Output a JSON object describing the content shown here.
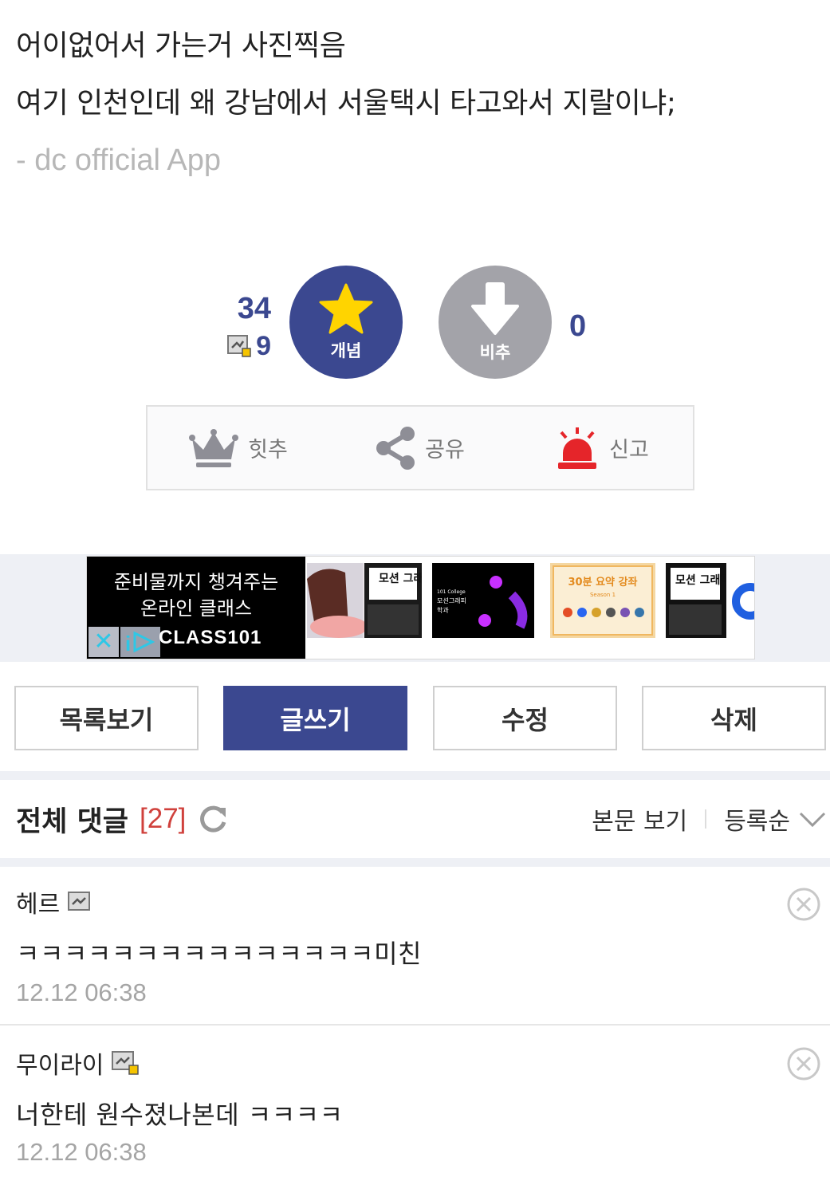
{
  "post": {
    "lines": [
      "어이없어서 가는거 사진찍음",
      "여기 인천인데 왜 강남에서 서울택시 타고와서 지랄이냐;"
    ],
    "app_sign": "- dc official App"
  },
  "recommend": {
    "up_count": "34",
    "fix_count": "9",
    "up_label": "개념",
    "down_label": "비추",
    "down_count": "0"
  },
  "actions": {
    "hit_label": "힛추",
    "share_label": "공유",
    "report_label": "신고"
  },
  "ad": {
    "line1": "준비물까지 챙겨주는",
    "line2": "온라인 클래스",
    "brand": "CLASS101",
    "thumb1_text": "모션 그래픽",
    "thumb2_lines": [
      "101 College",
      "모션그래피",
      "학과"
    ],
    "thumb3_title": "30분 요약 강좌",
    "thumb3_sub": "Season 1",
    "thumb4_text": "모션 그래픽"
  },
  "buttons": {
    "list": "목록보기",
    "write": "글쓰기",
    "edit": "수정",
    "delete": "삭제"
  },
  "comments_header": {
    "title": "전체 댓글",
    "count": "[27]",
    "view_body": "본문 보기",
    "sort": "등록순"
  },
  "comments": [
    {
      "author": "헤르",
      "text": "ㅋㅋㅋㅋㅋㅋㅋㅋㅋㅋㅋㅋㅋㅋㅋ미친",
      "date": "12.12 06:38"
    },
    {
      "author": "무이라이",
      "text": "너한테 원수졌나본데 ㅋㅋㅋㅋ",
      "date": "12.12 06:38"
    }
  ],
  "colors": {
    "accent": "#3b4890",
    "downvote": "#a3a3a9",
    "count_red": "#d0413c",
    "star": "#ffd400",
    "siren": "#e5252a"
  }
}
